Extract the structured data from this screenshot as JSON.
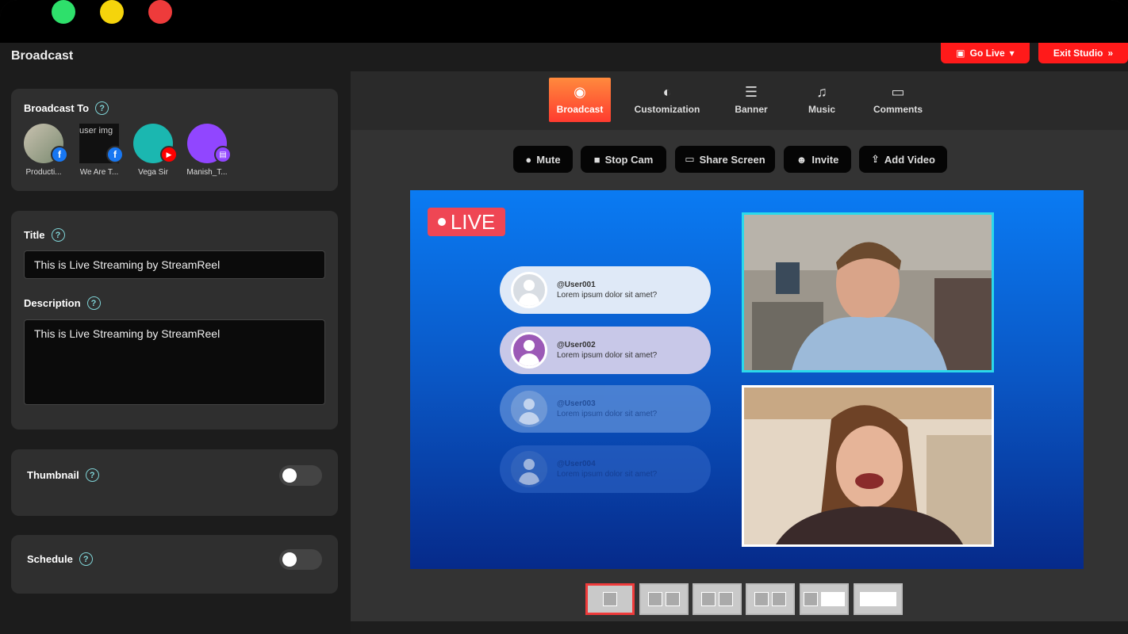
{
  "window": {
    "title": "Broadcast"
  },
  "header": {
    "go_live_label": "Go Live",
    "exit_studio_label": "Exit Studio"
  },
  "broadcast_to": {
    "label": "Broadcast To",
    "accounts": [
      {
        "name": "Producti...",
        "platform": "facebook"
      },
      {
        "name": "We Are T...",
        "platform": "facebook",
        "broken_image_alt": "user img"
      },
      {
        "name": "Vega Sir",
        "platform": "youtube"
      },
      {
        "name": "Manish_T...",
        "platform": "twitch"
      }
    ]
  },
  "title_field": {
    "label": "Title",
    "value": "This is Live Streaming by StreamReel"
  },
  "description_field": {
    "label": "Description",
    "value": "This is Live Streaming by StreamReel"
  },
  "thumbnail": {
    "label": "Thumbnail",
    "enabled": false
  },
  "schedule": {
    "label": "Schedule",
    "enabled": false
  },
  "tabs": [
    {
      "label": "Broadcast",
      "icon": "broadcast-icon",
      "active": true
    },
    {
      "label": "Customization",
      "icon": "palette-icon"
    },
    {
      "label": "Banner",
      "icon": "banner-icon"
    },
    {
      "label": "Music",
      "icon": "music-icon"
    },
    {
      "label": "Comments",
      "icon": "comment-icon"
    }
  ],
  "controls": [
    {
      "label": "Mute",
      "icon": "mic-icon"
    },
    {
      "label": "Stop Cam",
      "icon": "camera-icon"
    },
    {
      "label": "Share Screen",
      "icon": "screen-icon"
    },
    {
      "label": "Invite",
      "icon": "add-user-icon"
    },
    {
      "label": "Add Video",
      "icon": "upload-icon"
    }
  ],
  "stage": {
    "live_label": "LIVE",
    "comments": [
      {
        "user": "@User001",
        "text": "Lorem ipsum dolor sit amet?"
      },
      {
        "user": "@User002",
        "text": "Lorem ipsum dolor sit amet?"
      },
      {
        "user": "@User003",
        "text": "Lorem ipsum dolor sit amet?"
      },
      {
        "user": "@User004",
        "text": "Lorem ipsum dolor sit amet?"
      }
    ]
  },
  "layouts": [
    "single",
    "two",
    "two-small",
    "grid",
    "side",
    "full"
  ],
  "colors": {
    "accent_red": "#ff1a1a",
    "live_red": "#ef4654",
    "cam_highlight": "#2bd9ea"
  }
}
